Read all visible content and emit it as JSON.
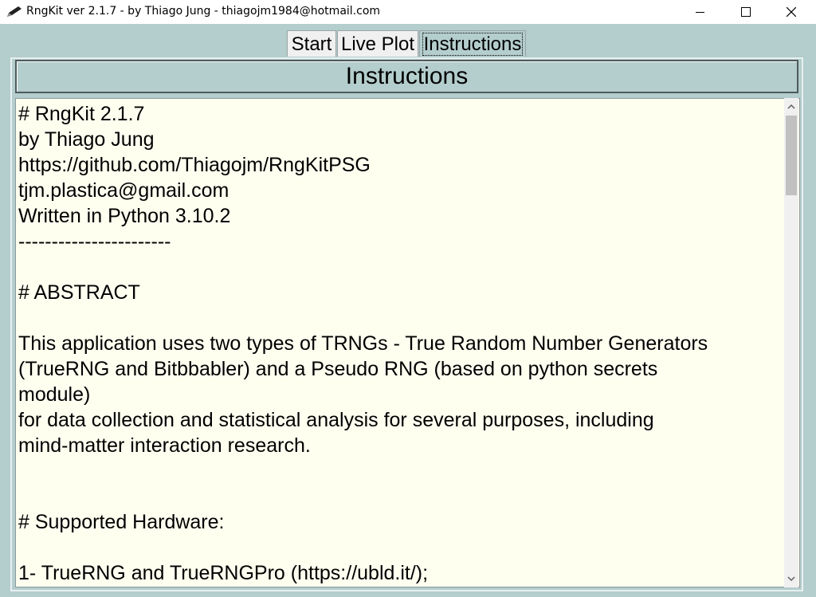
{
  "window": {
    "title": "RngKit ver 2.1.7 - by Thiago Jung - thiagojm1984@hotmail.com"
  },
  "tabs": [
    {
      "label": "Start"
    },
    {
      "label": "Live Plot"
    },
    {
      "label": "Instructions"
    }
  ],
  "panel": {
    "heading": "Instructions"
  },
  "text": {
    "lines": [
      "# RngKit 2.1.7",
      "by Thiago Jung",
      "https://github.com/Thiagojm/RngKitPSG",
      "tjm.plastica@gmail.com",
      "Written in Python 3.10.2",
      "-----------------------",
      "",
      "# ABSTRACT",
      "",
      "This application uses two types of TRNGs - True Random Number Generators",
      "(TrueRNG and Bitbbabler) and a Pseudo RNG (based on python secrets",
      "module)",
      "for data collection and statistical analysis for several purposes, including",
      "mind-matter interaction research.",
      "",
      "",
      "# Supported Hardware:",
      "",
      "1- TrueRNG and TrueRNGPro (https://ubld.it/);"
    ]
  },
  "icons": {
    "app": "pen-icon",
    "minimize": "minimize-icon",
    "maximize": "maximize-icon",
    "close": "close-icon"
  }
}
